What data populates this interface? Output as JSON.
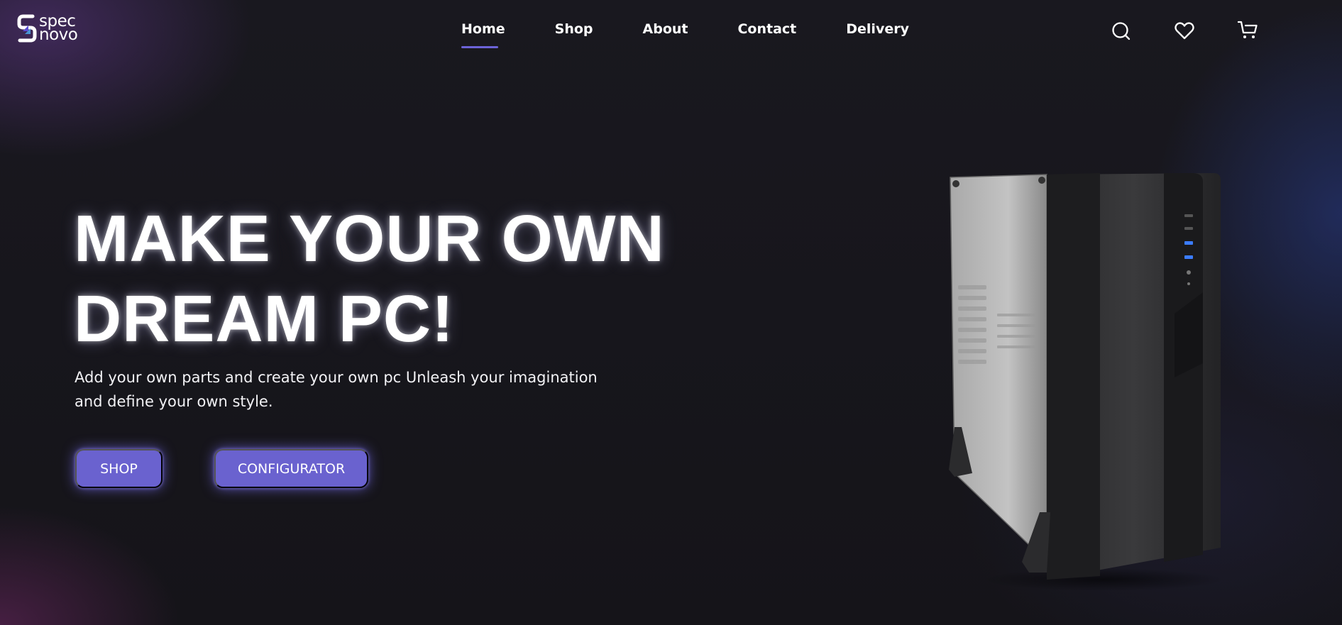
{
  "brand": {
    "line1": "spec",
    "line2": "novo"
  },
  "nav": {
    "links": [
      {
        "label": "Home",
        "active": true
      },
      {
        "label": "Shop",
        "active": false
      },
      {
        "label": "About",
        "active": false
      },
      {
        "label": "Contact",
        "active": false
      },
      {
        "label": "Delivery",
        "active": false
      }
    ],
    "icons": [
      "search-icon",
      "heart-icon",
      "cart-icon"
    ]
  },
  "hero": {
    "title_line1": "MAKE YOUR OWN",
    "title_line2": "DREAM PC!",
    "subtitle": "Add your own parts and create your own pc Unleash your imagination and define your own style.",
    "buttons": {
      "shop": "SHOP",
      "configurator": "CONFIGURATOR"
    }
  },
  "colors": {
    "accent": "#6a62cf",
    "background": "#18171d",
    "text": "#ffffff"
  }
}
